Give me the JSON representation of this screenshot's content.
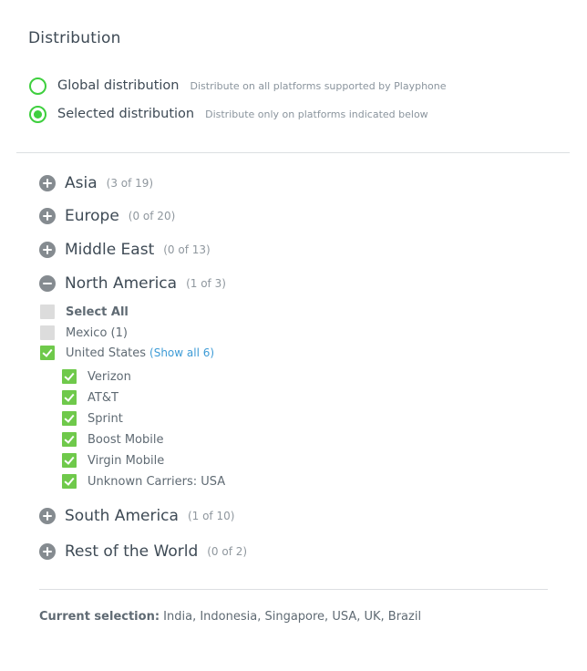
{
  "section": {
    "title": "Distribution"
  },
  "distribution": {
    "options": [
      {
        "label": "Global distribution",
        "description": "Distribute on all platforms supported by Playphone",
        "selected": false
      },
      {
        "label": "Selected distribution",
        "description": "Distribute only on platforms indicated below",
        "selected": true
      }
    ]
  },
  "regions": {
    "asia": {
      "name": "Asia",
      "count": "(3 of 19)",
      "expanded": false
    },
    "europe": {
      "name": "Europe",
      "count": "(0 of 20)",
      "expanded": false
    },
    "middle_east": {
      "name": "Middle East",
      "count": "(0 of 13)",
      "expanded": false
    },
    "north_america": {
      "name": "North America",
      "count": "(1 of 3)",
      "expanded": true,
      "select_all_label": "Select All",
      "countries": [
        {
          "label": "Mexico (1)",
          "checked": false
        },
        {
          "label": "United States",
          "checked": true,
          "show_all_label": "(Show all 6)"
        }
      ],
      "carriers": [
        {
          "label": "Verizon",
          "checked": true
        },
        {
          "label": "AT&T",
          "checked": true
        },
        {
          "label": "Sprint",
          "checked": true
        },
        {
          "label": "Boost Mobile",
          "checked": true
        },
        {
          "label": "Virgin Mobile",
          "checked": true
        },
        {
          "label": "Unknown Carriers: USA",
          "checked": true
        }
      ]
    },
    "south_america": {
      "name": "South America",
      "count": "(1 of 10)",
      "expanded": false
    },
    "rest_of_world": {
      "name": "Rest of the World",
      "count": "(0 of 2)",
      "expanded": false
    }
  },
  "current_selection": {
    "label": "Current selection:",
    "value": "India, Indonesia, Singapore, USA, UK, Brazil"
  },
  "colors": {
    "accent_green": "#3ecf3e",
    "checkbox_green": "#6fc94b",
    "link_blue": "#3d9bd6",
    "toggle_gray": "#858b90"
  }
}
